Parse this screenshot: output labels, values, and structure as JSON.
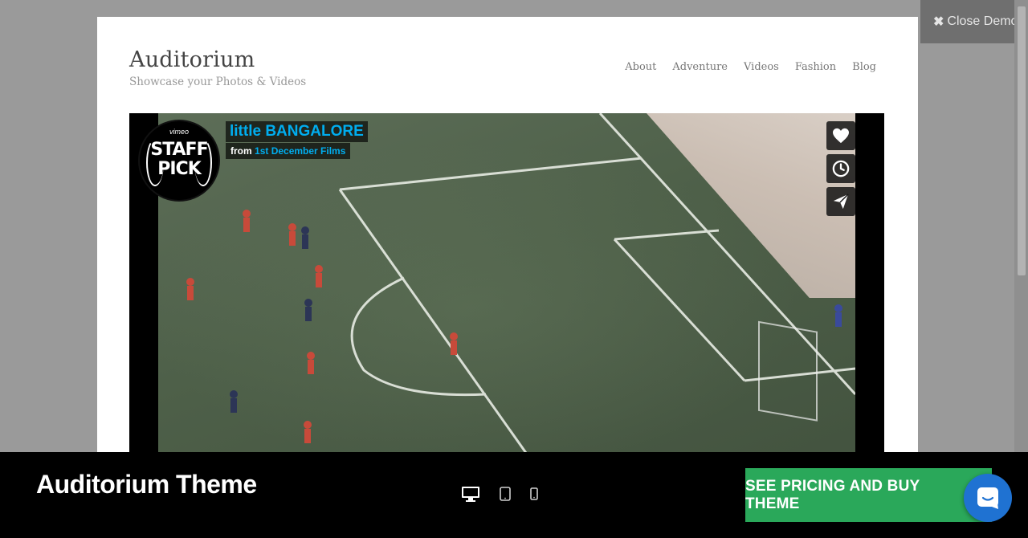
{
  "close_demo": {
    "icon": "close-icon",
    "label": "Close Demo"
  },
  "site": {
    "title": "Auditorium",
    "tagline": "Showcase your Photos & Videos",
    "nav": [
      {
        "label": "About"
      },
      {
        "label": "Adventure"
      },
      {
        "label": "Videos"
      },
      {
        "label": "Fashion"
      },
      {
        "label": "Blog"
      }
    ]
  },
  "video": {
    "badge": {
      "vimeo": "vimeo",
      "line1": "STAFF",
      "line2": "PICK"
    },
    "title": "little BANGALORE",
    "byline_prefix": "from",
    "byline_author": "1st December Films",
    "actions": [
      {
        "icon": "heart-icon"
      },
      {
        "icon": "clock-icon"
      },
      {
        "icon": "paper-plane-icon"
      }
    ]
  },
  "bottom_bar": {
    "theme_name": "Auditorium Theme",
    "devices": [
      {
        "icon": "desktop-icon",
        "active": true
      },
      {
        "icon": "tablet-icon",
        "active": false
      },
      {
        "icon": "mobile-icon",
        "active": false
      }
    ],
    "buy_label": "SEE PRICING AND BUY THEME",
    "chat_icon": "chat-icon"
  },
  "colors": {
    "vimeo_blue": "#00adef",
    "buy_green": "#2aa85a",
    "chat_blue": "#1f72d2"
  }
}
